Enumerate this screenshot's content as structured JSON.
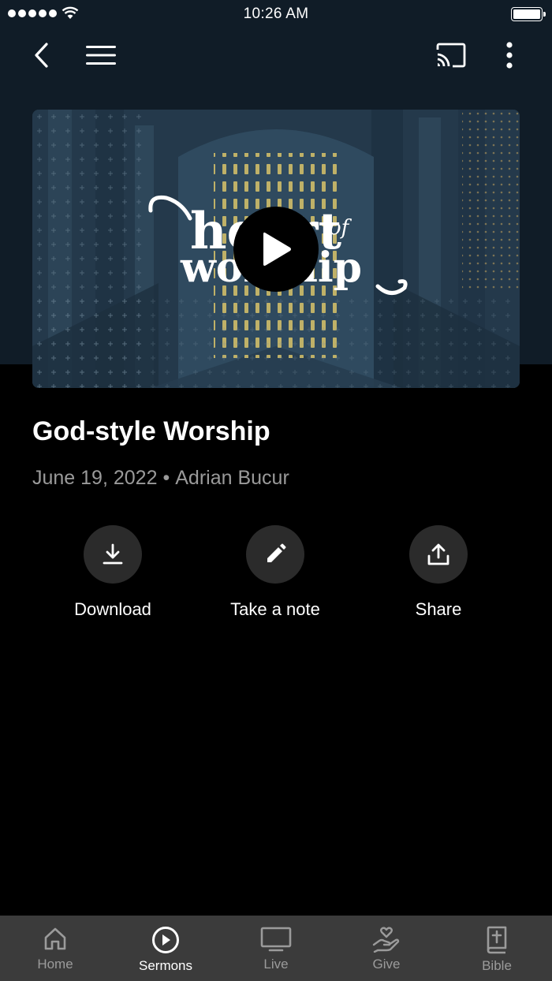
{
  "status_bar": {
    "time": "10:26 AM"
  },
  "hero": {
    "title_line1": "heart",
    "title_small": "of",
    "title_line2": "worship"
  },
  "sermon": {
    "title": "God-style Worship",
    "date": "June 19, 2022",
    "separator": "•",
    "speaker": "Adrian Bucur"
  },
  "actions": {
    "download": "Download",
    "note": "Take a note",
    "share": "Share"
  },
  "tabs": [
    {
      "label": "Home",
      "icon": "home-icon",
      "active": false
    },
    {
      "label": "Sermons",
      "icon": "play-circle-icon",
      "active": true
    },
    {
      "label": "Live",
      "icon": "tv-icon",
      "active": false
    },
    {
      "label": "Give",
      "icon": "heart-hand-icon",
      "active": false
    },
    {
      "label": "Bible",
      "icon": "bible-icon",
      "active": false
    }
  ],
  "colors": {
    "header_bg": "#101c27",
    "tab_bar_bg": "#3b3b3b",
    "action_circle": "#2b2b2b",
    "meta_text": "#9a9a9a"
  }
}
